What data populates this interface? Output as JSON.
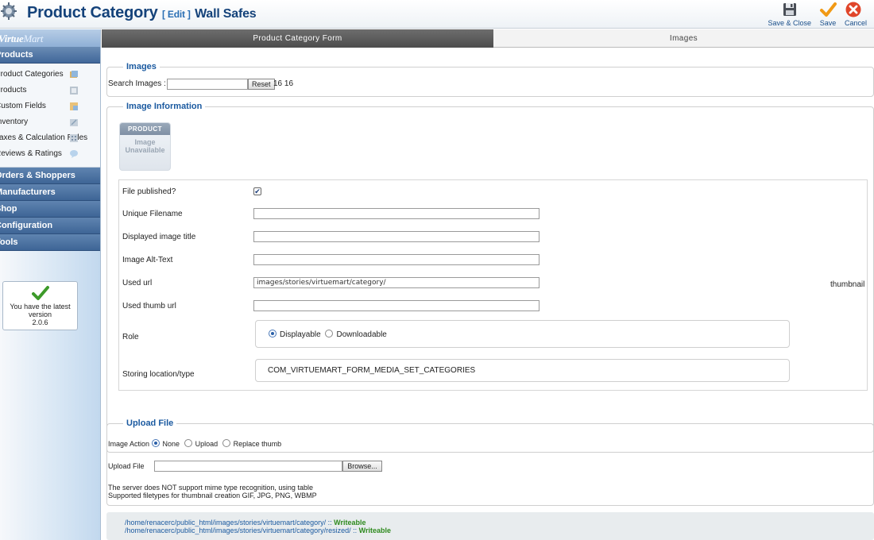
{
  "header": {
    "title": "Product Category",
    "edit_label": "[ Edit ]",
    "item_name": "Wall Safes"
  },
  "toolbar": {
    "save_close": "Save & Close",
    "save": "Save",
    "cancel": "Cancel"
  },
  "sidebar": {
    "brand_virtue": "Virtue",
    "brand_mart": "Mart",
    "products_section": "Products",
    "items": [
      {
        "label": "Product Categories"
      },
      {
        "label": "Products"
      },
      {
        "label": "Custom Fields"
      },
      {
        "label": "Inventory"
      },
      {
        "label": "Taxes & Calculation Rules"
      },
      {
        "label": "Reviews & Ratings"
      }
    ],
    "sections": [
      {
        "label": "Orders & Shoppers"
      },
      {
        "label": "Manufacturers"
      },
      {
        "label": "Shop"
      },
      {
        "label": "Configuration"
      },
      {
        "label": "Tools"
      }
    ],
    "version": {
      "line1": "You have the latest",
      "line2": "version",
      "line3": "2.0.6"
    }
  },
  "tabs": [
    {
      "label": "Product Category Form"
    },
    {
      "label": "Images"
    }
  ],
  "images": {
    "legend": "Images",
    "search_label": "Search Images :",
    "search_value": "",
    "reset": "Reset",
    "counts": "16 16"
  },
  "info": {
    "legend": "Image Information",
    "placeholder_top": "PRODUCT",
    "placeholder_mid1": "Image",
    "placeholder_mid2": "Unavailable",
    "published_label": "File published?",
    "published_checked": true,
    "unique_label": "Unique Filename",
    "unique_value": "",
    "title_label": "Displayed image title",
    "title_value": "",
    "alt_label": "Image Alt-Text",
    "alt_value": "",
    "url_label": "Used url",
    "url_value": "images/stories/virtuemart/category/",
    "thumb_label": "Used thumb url",
    "thumb_value": "",
    "thumbnail_text": "thumbnail",
    "role_label": "Role",
    "role_opt1": "Displayable",
    "role_opt2": "Downloadable",
    "role_selected": "Displayable",
    "storing_label": "Storing location/type",
    "storing_value": "COM_VIRTUEMART_FORM_MEDIA_SET_CATEGORIES"
  },
  "upload": {
    "legend": "Upload File",
    "action_label": "Image Action",
    "opt_none": "None",
    "opt_upload": "Upload",
    "opt_replace": "Replace thumb",
    "action_selected": "None",
    "file_label": "Upload File",
    "browse": "Browse...",
    "note1": "The server does NOT support mime type recognition, using table",
    "note2": "Supported filetypes for thumbnail creation GIF, JPG, PNG, WBMP"
  },
  "storage": {
    "path1": "/home/renacerc/public_html/images/stories/virtuemart/category/ :: ",
    "path2": "/home/renacerc/public_html/images/stories/virtuemart/category/resized/ :: ",
    "status": "Writeable"
  }
}
